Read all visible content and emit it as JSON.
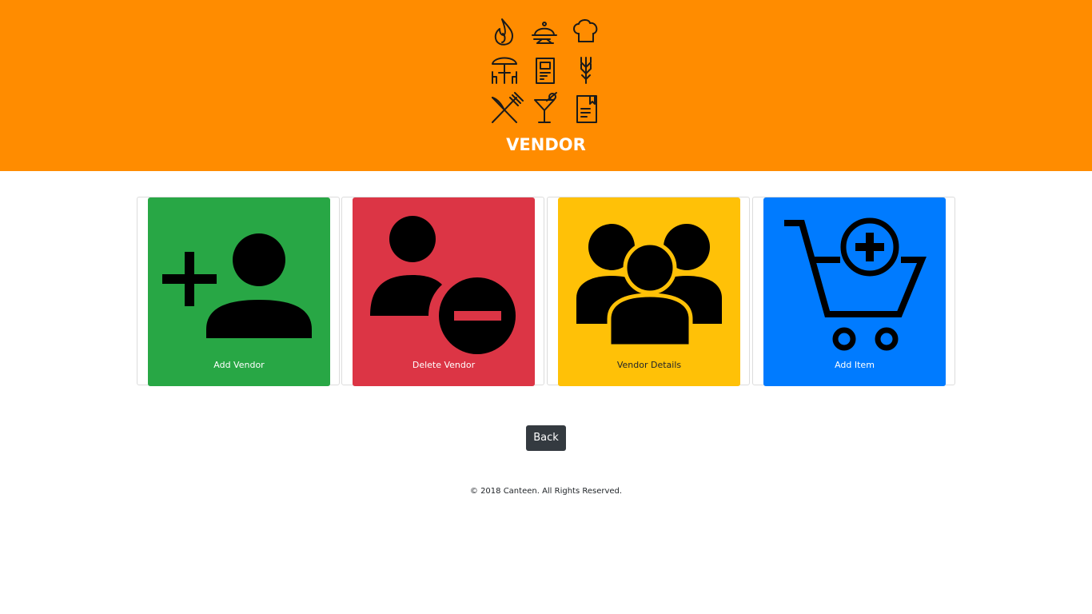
{
  "header": {
    "title": "VENDOR",
    "background": "#ff8c00",
    "logo_icons": [
      "flame-icon",
      "cloche-icon",
      "chef-hat-icon",
      "table-umbrella-icon",
      "menu-icon",
      "wheat-icon",
      "knife-fork-icon",
      "cocktail-icon",
      "recipe-book-icon"
    ]
  },
  "tiles": [
    {
      "label": "Add Vendor",
      "color": "#28a745",
      "text_color": "#ffffff",
      "icon": "add-user-icon"
    },
    {
      "label": "Delete Vendor",
      "color": "#dc3545",
      "text_color": "#ffffff",
      "icon": "remove-user-icon"
    },
    {
      "label": "Vendor Details",
      "color": "#ffc107",
      "text_color": "#212529",
      "icon": "group-icon"
    },
    {
      "label": "Add Item",
      "color": "#007bff",
      "text_color": "#ffffff",
      "icon": "cart-add-icon"
    }
  ],
  "actions": {
    "back_label": "Back"
  },
  "footer": {
    "copyright": "© 2018 Canteen. All Rights Reserved."
  }
}
